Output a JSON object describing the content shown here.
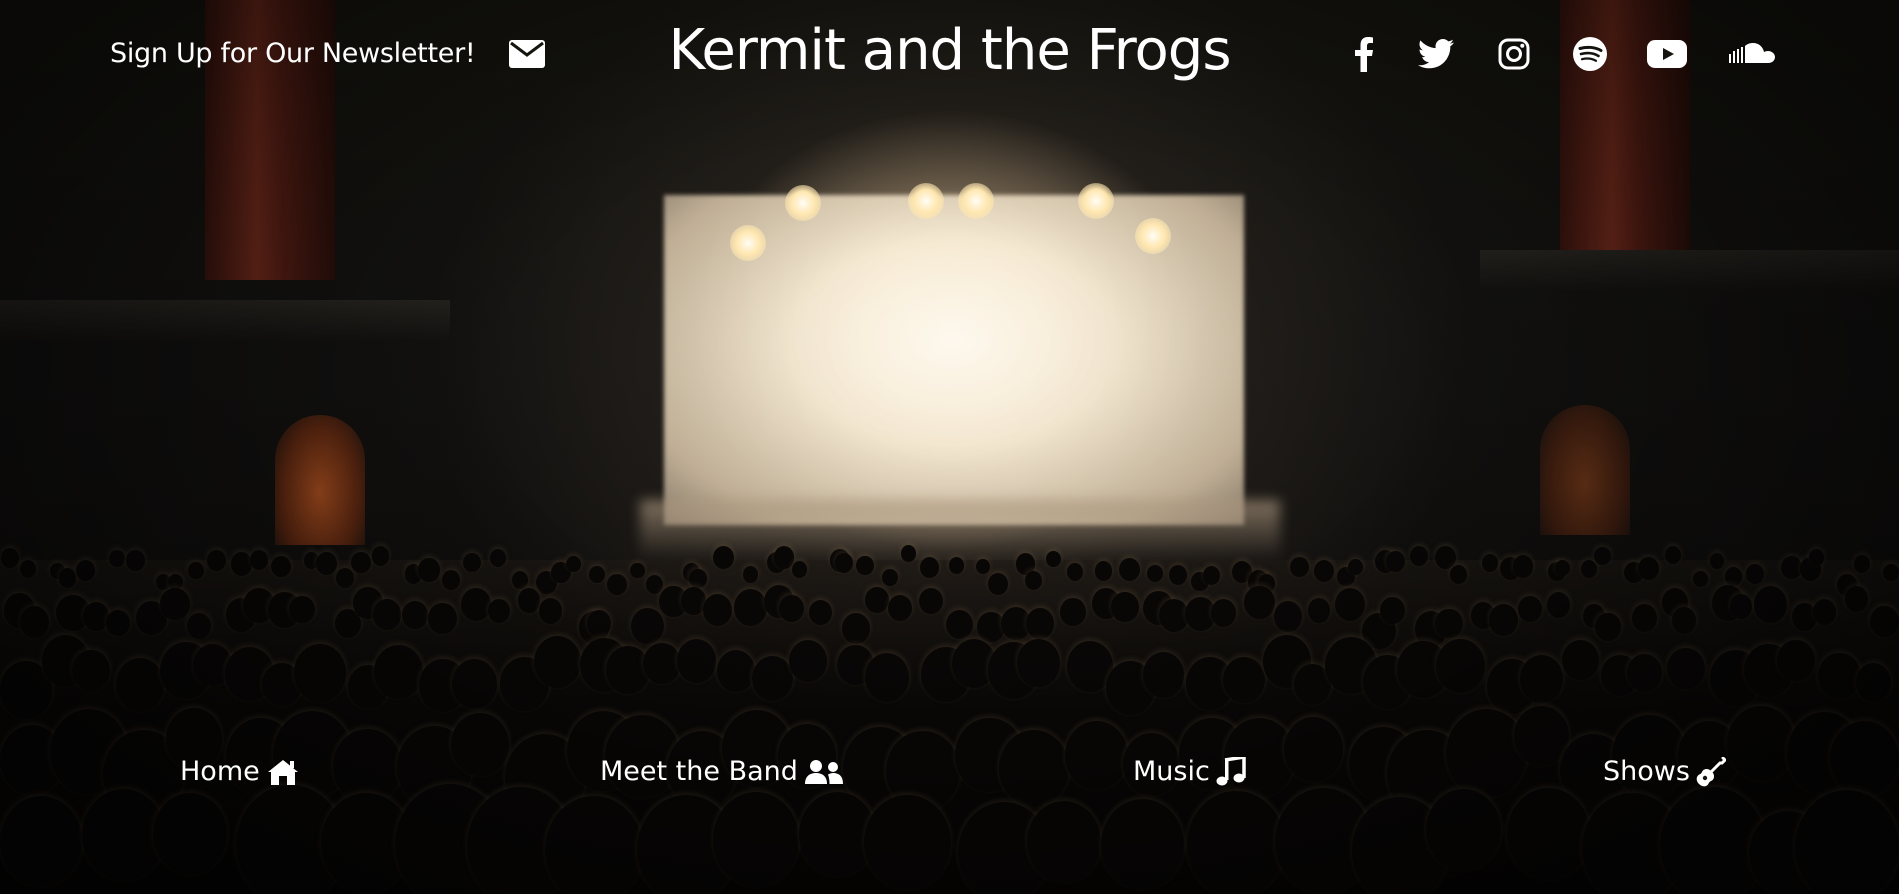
{
  "header": {
    "newsletter_label": "Sign Up for Our Newsletter!",
    "newsletter_icon": "envelope-icon",
    "title": "Kermit and the Frogs"
  },
  "socials": [
    {
      "name": "facebook",
      "icon": "facebook-icon"
    },
    {
      "name": "twitter",
      "icon": "twitter-icon"
    },
    {
      "name": "instagram",
      "icon": "instagram-icon"
    },
    {
      "name": "spotify",
      "icon": "spotify-icon"
    },
    {
      "name": "youtube",
      "icon": "youtube-icon"
    },
    {
      "name": "soundcloud",
      "icon": "soundcloud-icon"
    }
  ],
  "nav": {
    "items": [
      {
        "label": "Home",
        "icon": "home-icon"
      },
      {
        "label": "Meet the Band",
        "icon": "users-icon"
      },
      {
        "label": "Music",
        "icon": "music-note-icon"
      },
      {
        "label": "Shows",
        "icon": "guitar-icon"
      }
    ]
  },
  "colors": {
    "text": "#ffffff",
    "background": "#0c0a08",
    "stage_light": "#fbefd8",
    "curtain": "#7a2c1c"
  },
  "background_image": {
    "description_icon": "concert-crowd-photo"
  }
}
